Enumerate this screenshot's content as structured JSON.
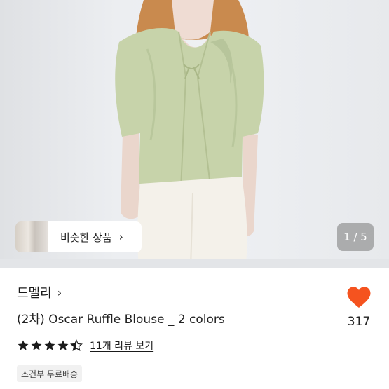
{
  "photo": {
    "similar_label": "비슷한 상품",
    "counter": "1 / 5",
    "icons": {
      "chevron": "chevron-right-icon"
    }
  },
  "product": {
    "shop_name": "드멜리",
    "title": "(2차) Oscar Ruffle Blouse _ 2 colors",
    "rating": 4.5,
    "review_link": "11개 리뷰 보기",
    "badge": "조건부 무료배송",
    "like_count": "317"
  },
  "colors": {
    "heart": "#f5531f",
    "star": "#1a1a1a",
    "blouse": "#c7d3aa"
  },
  "icons": [
    "chevron-right-icon",
    "heart-icon",
    "star-icon"
  ]
}
